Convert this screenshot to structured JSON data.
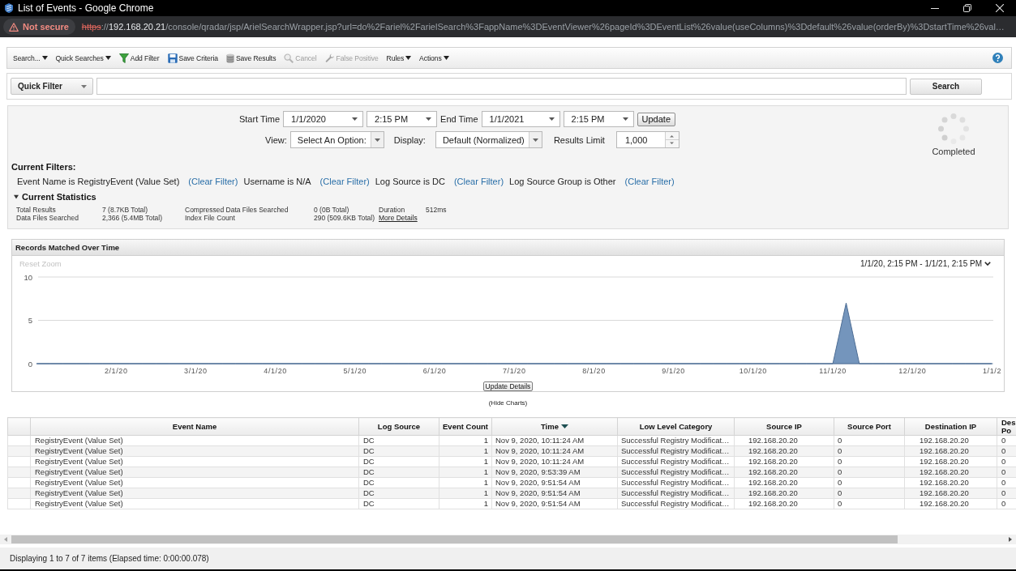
{
  "window": {
    "title": "List of Events - Google Chrome"
  },
  "address_bar": {
    "secure": false,
    "security_label": "Not secure",
    "scheme": "https",
    "separator": "://",
    "host": "192.168.20.21",
    "path": "/console/qradar/jsp/ArielSearchWrapper.jsp?url=do%2Fariel%2FarielSearch%3FappName%3DEventViewer%26pageId%3DEventList%26value(useColumns)%3Ddefault%26value(orderBy)%3DstartTime%26val…"
  },
  "toolbar": {
    "items": [
      {
        "label": "Search...",
        "kind": "menu",
        "disabled": false
      },
      {
        "label": "Quick Searches",
        "kind": "menu",
        "disabled": false
      },
      {
        "label": "Add Filter",
        "kind": "action",
        "disabled": false
      },
      {
        "label": "Save Criteria",
        "kind": "action",
        "disabled": false
      },
      {
        "label": "Save Results",
        "kind": "action",
        "disabled": false
      },
      {
        "label": "Cancel",
        "kind": "action",
        "disabled": true
      },
      {
        "label": "False Positive",
        "kind": "action",
        "disabled": true
      },
      {
        "label": "Rules",
        "kind": "menu",
        "disabled": false
      },
      {
        "label": "Actions",
        "kind": "menu",
        "disabled": false
      }
    ]
  },
  "quick_filter": {
    "selector": "Quick Filter",
    "search_button": "Search"
  },
  "search_parameters": {
    "start_label": "Start Time",
    "start_date": "1/1/2020",
    "start_time": "2:15 PM",
    "end_label": "End Time",
    "end_date": "1/1/2021",
    "end_time": "2:15 PM",
    "update_button": "Update",
    "view_label": "View:",
    "view": "Select An Option:",
    "display_label": "Display:",
    "display": "Default (Normalized)",
    "limit_label": "Results Limit",
    "limit": "1,000",
    "status": "Completed"
  },
  "current_filters": {
    "title": "Current Filters:",
    "filters": [
      {
        "text": "Event Name is RegistryEvent (Value Set)",
        "clear_link": "(Clear Filter)"
      },
      {
        "text": "Username is N/A",
        "clear_link": "(Clear Filter)"
      },
      {
        "text": "Log Source is DC",
        "clear_link": "(Clear Filter)"
      },
      {
        "text": "Log Source Group is Other",
        "clear_link": "(Clear Filter)"
      }
    ]
  },
  "current_statistics": {
    "title": "Current Statistics",
    "expanded": true,
    "rows": [
      [
        {
          "label": "Total Results",
          "value": "7 (8.7KB Total)"
        },
        {
          "label": "Compressed Data Files Searched",
          "value": "0 (0B Total)"
        },
        {
          "label": "Duration",
          "value": "512ms"
        }
      ],
      [
        {
          "label": "Data Files Searched",
          "value": "2,366 (5.4MB Total)"
        },
        {
          "label": "Index File Count",
          "value": "290 (509.6KB Total)"
        }
      ]
    ],
    "details_link": "More Details"
  },
  "chart_panel": {
    "title": "Records Matched Over Time",
    "reset_zoom": {
      "label": "Reset Zoom",
      "disabled": true
    },
    "range": "1/1/20, 2:15 PM - 1/1/21, 2:15 PM",
    "update_button": "Update Details",
    "chart_data": {
      "type": "area",
      "categories": [
        null,
        null,
        null,
        null,
        null,
        null,
        "2/1/20",
        null,
        null,
        null,
        null,
        null,
        "3/1/20",
        null,
        null,
        null,
        null,
        null,
        "4/1/20",
        null,
        null,
        null,
        null,
        null,
        "5/1/20",
        null,
        null,
        null,
        null,
        null,
        "6/1/20",
        null,
        null,
        null,
        null,
        null,
        "7/1/20",
        null,
        null,
        null,
        null,
        null,
        "8/1/20",
        null,
        null,
        null,
        null,
        null,
        "9/1/20",
        null,
        null,
        null,
        null,
        null,
        "10/1/20",
        null,
        null,
        null,
        null,
        null,
        "11/1/20",
        null,
        null,
        null,
        null,
        null,
        "12/1/20",
        null,
        null,
        null,
        null,
        null,
        "1/1/2"
      ],
      "values": [
        0,
        0,
        0,
        0,
        0,
        0,
        0,
        0,
        0,
        0,
        0,
        0,
        0,
        0,
        0,
        0,
        0,
        0,
        0,
        0,
        0,
        0,
        0,
        0,
        0,
        0,
        0,
        0,
        0,
        0,
        0,
        0,
        0,
        0,
        0,
        0,
        0,
        0,
        0,
        0,
        0,
        0,
        0,
        0,
        0,
        0,
        0,
        0,
        0,
        0,
        0,
        0,
        0,
        0,
        0,
        0,
        0,
        0,
        0,
        0,
        0,
        7,
        0,
        0,
        0,
        0,
        0,
        0,
        0,
        0,
        0,
        0,
        0
      ],
      "ylim": [
        0,
        10
      ],
      "yticks": [
        0,
        5,
        10
      ]
    }
  },
  "hide_charts_link": "(Hide Charts)",
  "table": {
    "columns": [
      {
        "label": "Event Name",
        "sorted": false
      },
      {
        "label": "Log Source",
        "sorted": false
      },
      {
        "label": "Event Count",
        "sorted": false
      },
      {
        "label": "Time",
        "sorted": true
      },
      {
        "label": "Low Level Category",
        "sorted": false
      },
      {
        "label": "Source IP",
        "sorted": false
      },
      {
        "label": "Source Port",
        "sorted": false
      },
      {
        "label": "Destination IP",
        "sorted": false
      },
      {
        "label": "Des Po",
        "sorted": false
      }
    ],
    "rows": [
      [
        "RegistryEvent (Value Set)",
        "DC",
        "1",
        "Nov 9, 2020, 10:11:24 AM",
        "Successful Registry Modificat…",
        "192.168.20.20",
        "0",
        "192.168.20.20",
        "0"
      ],
      [
        "RegistryEvent (Value Set)",
        "DC",
        "1",
        "Nov 9, 2020, 10:11:24 AM",
        "Successful Registry Modificat…",
        "192.168.20.20",
        "0",
        "192.168.20.20",
        "0"
      ],
      [
        "RegistryEvent (Value Set)",
        "DC",
        "1",
        "Nov 9, 2020, 10:11:24 AM",
        "Successful Registry Modificat…",
        "192.168.20.20",
        "0",
        "192.168.20.20",
        "0"
      ],
      [
        "RegistryEvent (Value Set)",
        "DC",
        "1",
        "Nov 9, 2020, 9:53:39 AM",
        "Successful Registry Modificat…",
        "192.168.20.20",
        "0",
        "192.168.20.20",
        "0"
      ],
      [
        "RegistryEvent (Value Set)",
        "DC",
        "1",
        "Nov 9, 2020, 9:51:54 AM",
        "Successful Registry Modificat…",
        "192.168.20.20",
        "0",
        "192.168.20.20",
        "0"
      ],
      [
        "RegistryEvent (Value Set)",
        "DC",
        "1",
        "Nov 9, 2020, 9:51:54 AM",
        "Successful Registry Modificat…",
        "192.168.20.20",
        "0",
        "192.168.20.20",
        "0"
      ],
      [
        "RegistryEvent (Value Set)",
        "DC",
        "1",
        "Nov 9, 2020, 9:51:54 AM",
        "Successful Registry Modificat…",
        "192.168.20.20",
        "0",
        "192.168.20.20",
        "0"
      ]
    ]
  },
  "status_bar": {
    "text": "Displaying 1 to 7 of 7 items (Elapsed time: 0:00:00.078)"
  }
}
